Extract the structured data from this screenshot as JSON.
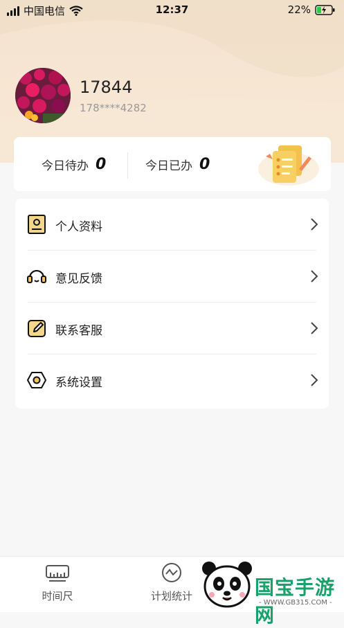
{
  "status_bar": {
    "carrier": "中国电信",
    "time": "12:37",
    "battery": "22%"
  },
  "profile": {
    "name": "17844",
    "phone": "178****4282"
  },
  "stats": {
    "todo_label": "今日待办",
    "todo_value": "0",
    "done_label": "今日已办",
    "done_value": "0"
  },
  "menu": {
    "items": [
      {
        "label": "个人资料",
        "icon": "id-card-icon"
      },
      {
        "label": "意见反馈",
        "icon": "headset-icon"
      },
      {
        "label": "联系客服",
        "icon": "edit-note-icon"
      },
      {
        "label": "系统设置",
        "icon": "gear-hexagon-icon"
      }
    ]
  },
  "tabbar": {
    "tabs": [
      {
        "label": "时间尺",
        "icon": "ruler-icon"
      },
      {
        "label": "计划统计",
        "icon": "chart-circle-icon"
      }
    ]
  },
  "watermark": {
    "title": "国宝手游网",
    "sub": "- WWW.GB315.COM -"
  },
  "colors": {
    "hero_bg": "#f3e3cf",
    "accent": "#e8b94a"
  }
}
